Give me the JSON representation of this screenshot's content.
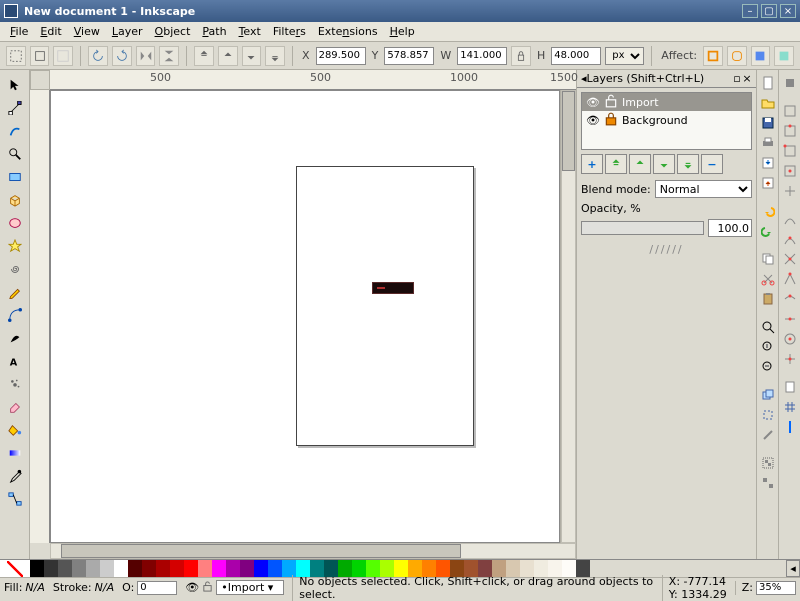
{
  "titlebar": {
    "title": "New document 1 - Inkscape"
  },
  "menubar": [
    "File",
    "Edit",
    "View",
    "Layer",
    "Object",
    "Path",
    "Text",
    "Filters",
    "Extensions",
    "Help"
  ],
  "coord": {
    "xlabel": "X",
    "x": "289.500",
    "ylabel": "Y",
    "y": "578.857",
    "wlabel": "W",
    "w": "141.000",
    "hlabel": "H",
    "h": "48.000",
    "unit": "px",
    "affect": "Affect:"
  },
  "ruler": [
    "500",
    "500",
    "1000",
    "1500"
  ],
  "layers": {
    "panel_title": "Layers (Shift+Ctrl+L)",
    "items": [
      {
        "name": "Import",
        "selected": true,
        "locked": false
      },
      {
        "name": "Background",
        "selected": false,
        "locked": true
      }
    ],
    "blend_label": "Blend mode:",
    "blend_value": "Normal",
    "opacity_label": "Opacity, %",
    "opacity_value": "100.0"
  },
  "status": {
    "fill_label": "Fill:",
    "fill_value": "N/A",
    "stroke_label": "Stroke:",
    "stroke_value": "N/A",
    "o_label": "O:",
    "o_value": "0",
    "layer": "Import",
    "message": "No objects selected. Click, Shift+click, or drag around objects to select.",
    "x_label": "X:",
    "x": "-777.14",
    "y_label": "Y:",
    "y": "1334.29",
    "z_label": "Z:",
    "z": "35%"
  },
  "palette": [
    "#000000",
    "#333333",
    "#555555",
    "#808080",
    "#aaaaaa",
    "#cccccc",
    "#ffffff",
    "#550000",
    "#800000",
    "#aa0000",
    "#d40000",
    "#ff0000",
    "#ff8080",
    "#ff00ff",
    "#aa00aa",
    "#800080",
    "#0000ff",
    "#0055ff",
    "#00aaff",
    "#00ffff",
    "#008080",
    "#005555",
    "#00aa00",
    "#00d400",
    "#55ff00",
    "#aaff00",
    "#ffff00",
    "#ffaa00",
    "#ff8000",
    "#ff5500",
    "#8b4513",
    "#a0522d",
    "#804040",
    "#c0a080",
    "#d8c8b0",
    "#e8e0d0",
    "#f0ece0",
    "#f8f4ec",
    "#fefcf8",
    "#444444"
  ]
}
